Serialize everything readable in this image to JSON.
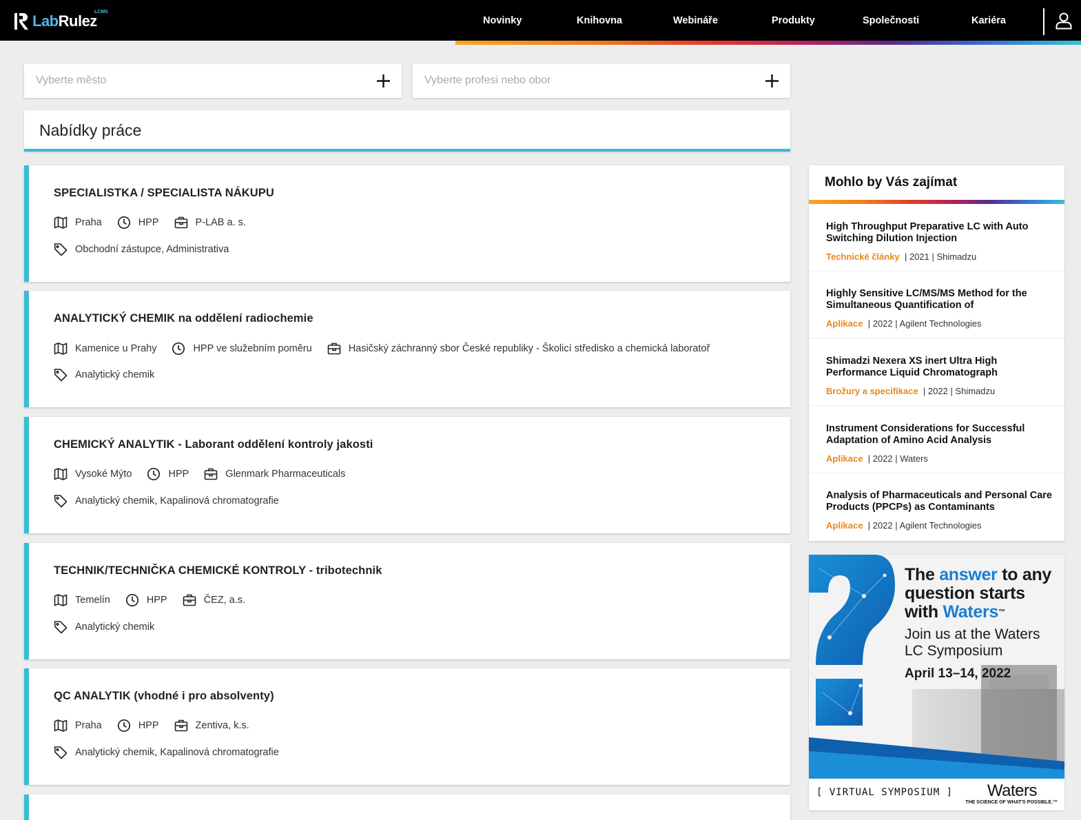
{
  "header": {
    "logo_lab": "Lab",
    "logo_rulez": "Rulez",
    "logo_sup": "LCMS",
    "nav": [
      {
        "label": "Novinky"
      },
      {
        "label": "Knihovna"
      },
      {
        "label": "Webináře"
      },
      {
        "label": "Produkty"
      },
      {
        "label": "Společnosti"
      },
      {
        "label": "Kariéra"
      }
    ]
  },
  "filters": {
    "city_placeholder": "Vyberte město",
    "field_placeholder": "Vyberte profesi nebo obor"
  },
  "section_title": "Nabídky práce",
  "jobs": [
    {
      "title": "SPECIALISTKA / SPECIALISTA NÁKUPU",
      "location": "Praha",
      "type": "HPP",
      "company": "P-LAB a. s.",
      "tags": "Obchodní zástupce, Administrativa"
    },
    {
      "title": "ANALYTICKÝ CHEMIK na oddělení radiochemie",
      "location": "Kamenice u Prahy",
      "type": "HPP ve služebním poměru",
      "company": "Hasičský záchranný sbor České republiky - Školicí středisko a chemická laboratoř",
      "tags": "Analytický chemik"
    },
    {
      "title": "CHEMICKÝ ANALYTIK - Laborant oddělení kontroly jakosti",
      "location": "Vysoké Mýto",
      "type": "HPP",
      "company": "Glenmark Pharmaceuticals",
      "tags": "Analytický chemik, Kapalinová chromatografie"
    },
    {
      "title": "TECHNIK/TECHNIČKA CHEMICKÉ KONTROLY - tribotechnik",
      "location": "Temelín",
      "type": "HPP",
      "company": "ČEZ, a.s.",
      "tags": "Analytický chemik"
    },
    {
      "title": "QC ANALYTIK (vhodné i pro absolventy)",
      "location": "Praha",
      "type": "HPP",
      "company": "Zentiva, k.s.",
      "tags": "Analytický chemik, Kapalinová chromatografie"
    }
  ],
  "sidebar": {
    "title": "Mohlo by Vás zajímat",
    "items": [
      {
        "title": "High Throughput Preparative LC with Auto Switching Dilution Injection",
        "category": "Technické články",
        "meta": "| 2021 | Shimadzu"
      },
      {
        "title": "Highly Sensitive LC/MS/MS Method for the Simultaneous Quantification of",
        "category": "Aplikace",
        "meta": "| 2022 | Agilent Technologies"
      },
      {
        "title": "Shimadzi Nexera XS inert Ultra High Performance Liquid Chromatograph",
        "category": "Brožury a specifikace",
        "meta": "| 2022 | Shimadzu"
      },
      {
        "title": "Instrument Considerations for Successful Adaptation of Amino Acid Analysis",
        "category": "Aplikace",
        "meta": "| 2022 | Waters"
      },
      {
        "title": "Analysis of Pharmaceuticals and Personal Care Products (PPCPs) as Contaminants",
        "category": "Aplikace",
        "meta": "| 2022 | Agilent Technologies"
      }
    ]
  },
  "ad": {
    "line1a": "The ",
    "line1b": "answer",
    "line1c": " to any",
    "line2": "question starts",
    "line3a": "with ",
    "line3b": "Waters",
    "tm": "™",
    "sub1": "Join us at the Waters",
    "sub2": "LC Symposium",
    "date": "April 13–14, 2022",
    "footer_label": "[ VIRTUAL SYMPOSIUM ]",
    "brand": "Waters",
    "tagline": "THE SCIENCE OF WHAT'S POSSIBLE.",
    "tm_small": "™"
  },
  "colors": {
    "accent": "#37bcd6",
    "category": "#e8871e",
    "header_bg": "#000000"
  }
}
